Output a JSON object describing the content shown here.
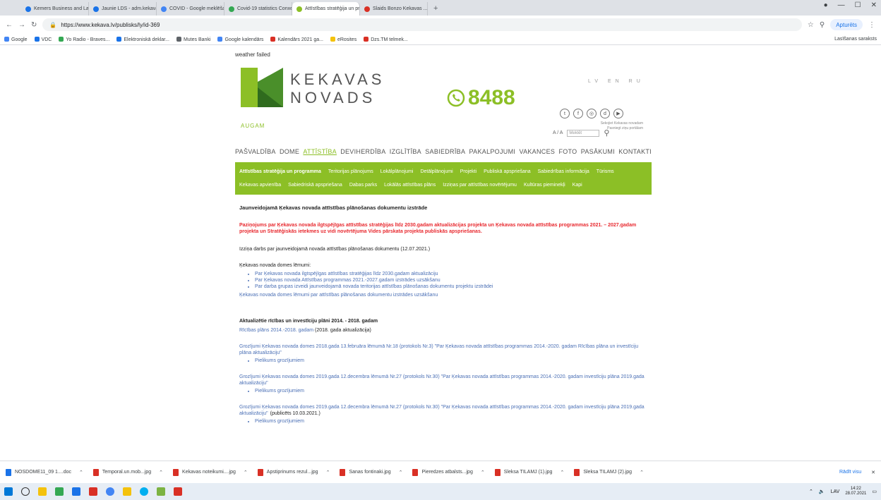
{
  "browser": {
    "tabs": [
      {
        "label": "Kemers Business and Law Consu...",
        "color": "#1a73e8",
        "active": false
      },
      {
        "label": "Jaunie LDS - adm.kekavas.lv",
        "color": "#1a73e8",
        "active": false
      },
      {
        "label": "COVID - Google meklēšana",
        "color": "#4285f4",
        "active": false
      },
      {
        "label": "Covid-19 statistics Conxelal dan...",
        "color": "#34a853",
        "active": false
      },
      {
        "label": "Attīstības stratēģija un programm...",
        "color": "#8cbf26",
        "active": true
      },
      {
        "label": "Slaids Bonzo Kekavas ...",
        "color": "#d93025",
        "active": false
      }
    ],
    "new_tab": "+",
    "url": "https://www.kekava.lv/publisks/ly/id-369",
    "profile_label": "Apturēts",
    "bookmarks": [
      "Google",
      "VDC",
      "Yo Radio - Braves...",
      "Elektroniskā deklar...",
      "Mutes Banki",
      "Google kalendārs",
      "Kalendārs 2021 ga...",
      "eRosites",
      "Dzs.TM telmek..."
    ],
    "reading_list": "Lasīšanas saraksts"
  },
  "site": {
    "weather": "weather failed",
    "logo_line1": "KEKAVAS",
    "logo_line2": "NOVADS",
    "tagline": "AUGAM",
    "phone": "8488",
    "lang": "LV EN RU",
    "social_note_1": "Sekojiet Kekavas novadam",
    "social_note_2": "Pasniegt ziņu portālam",
    "font_size_label": "A / A",
    "search_placeholder": "Meklēt",
    "nav": [
      "PAŠVALDĪBA",
      "DOME",
      "ATTĪSTĪBA",
      "DEVIHERDĪBA",
      "IZGLĪTĪBA",
      "SABIEDRĪBA",
      "PAKALPOJUMI",
      "VAKANCES",
      "FOTO",
      "PASĀKUMI",
      "KONTAKTI"
    ],
    "nav_active_index": 2,
    "subnav": [
      "Attīstības stratēģija un programma",
      "Teritorijas plānojums",
      "Lokālplānojumi",
      "Detālplānojumi",
      "Projekti",
      "Publiskā apspriešana",
      "Sabiedrības informācija",
      "Tūrisms",
      "Kekavas apvienība",
      "Sabiedriskā apspriešana",
      "Dabas parks",
      "Lokālās attīstības plāns",
      "Izziņas par attīstības novērtējumu",
      "Kultūras pieminekļi",
      "Kapi"
    ]
  },
  "content": {
    "heading": "Jaunveidojamā Ķekavas novada attīstības plānošanas dokumentu izstrāde",
    "red_notice": "Paziņojums par Ķekavas novada ilgtspējīgas attīstības stratēģijas līdz 2030.gadam aktualizācijas projekta un Ķekavas novada attīstības programmas 2021. – 2027.gadam projekta un Stratēģiskās ietekmes uz vidi novērtējuma Vides pārskata projekta publiskās apspriešanas.",
    "progress_note": "Izziņa darbs par jaunveidojamā novada attīstības plānošanas dokumentu (12.07.2021.)",
    "decisions_title": "Ķekavas novada domes lēmumi:",
    "decisions": [
      "Par Ķekavas novada ilgtspējīgas attīstības stratēģijas līdz 2030.gadam aktualizāciju",
      "Par Ķekavas novada Attīstības programmas 2021.-2027.gadam izstrādes uzsākšanu",
      "Par darba grupas izveidi jaunveidojamā novada teritorijas attīstības plānošanas dokumentu projektu izstrādei"
    ],
    "decisions_more": "Ķekavas novada domes lēmumi par attīstības plānošanas dokumentu izstrādes uzsākšanu",
    "section2_title": "Aktualizētie rīcības un investīciju plāni 2014. - 2018. gadam",
    "section2_link": "Rīcības plāns 2014.-2018. gadam",
    "section2_suffix": "(2018. gada aktualizācija)",
    "items": [
      {
        "text": "Grozījumi Ķekavas novada domes 2018.gada 13.februāra lēmumā Nr.18 (protokols Nr.3) \"Par Ķekavas novada attīstības programmas 2014.-2020. gadam Rīcības plāna un investīciju plāna aktualizāciju\"",
        "suffix": "",
        "bullet": "Pielikums grozījumiem"
      },
      {
        "text": "Grozījumi Ķekavas novada domes 2019.gada 12.decembra lēmumā Nr.27 (protokols Nr.30) \"Par Ķekavas novada attīstības programmas 2014.-2020. gadam investīciju plāna 2019.gada aktualizāciju\"",
        "suffix": "",
        "bullet": "Pielikums grozījumiem"
      },
      {
        "text": "Grozījumi Ķekavas novada domes 2019.gada 12.decembra lēmumā Nr.27 (protokols Nr.30) \"Par Ķekavas novada attīstības programmas 2014.-2020. gadam investīciju plāna 2019.gada aktualizāciju\"",
        "suffix": "(publicēts 10.03.2021.)",
        "bullet": "Pielikums grozījumiem"
      }
    ]
  },
  "downloads": [
    {
      "label": "NOSDOME11_09 1....doc",
      "type": "doc"
    },
    {
      "label": "Temporal.un.mob...jpg",
      "type": "img"
    },
    {
      "label": "Kekavas noteikumi....jpg",
      "type": "img"
    },
    {
      "label": "Apstiprinums rezul...jpg",
      "type": "img"
    },
    {
      "label": "Sanas fontinaki.jpg",
      "type": "img"
    },
    {
      "label": "Pieredzes atbalsts...jpg",
      "type": "img"
    },
    {
      "label": "Sleksa TILAMJ (1).jpg",
      "type": "img"
    },
    {
      "label": "Sleksa TILAMJ (2).jpg",
      "type": "img"
    }
  ],
  "downloads_show_all": "Rādīt visu",
  "taskbar": {
    "lang": "LAV",
    "time": "14:22",
    "date": "28.07.2021"
  }
}
